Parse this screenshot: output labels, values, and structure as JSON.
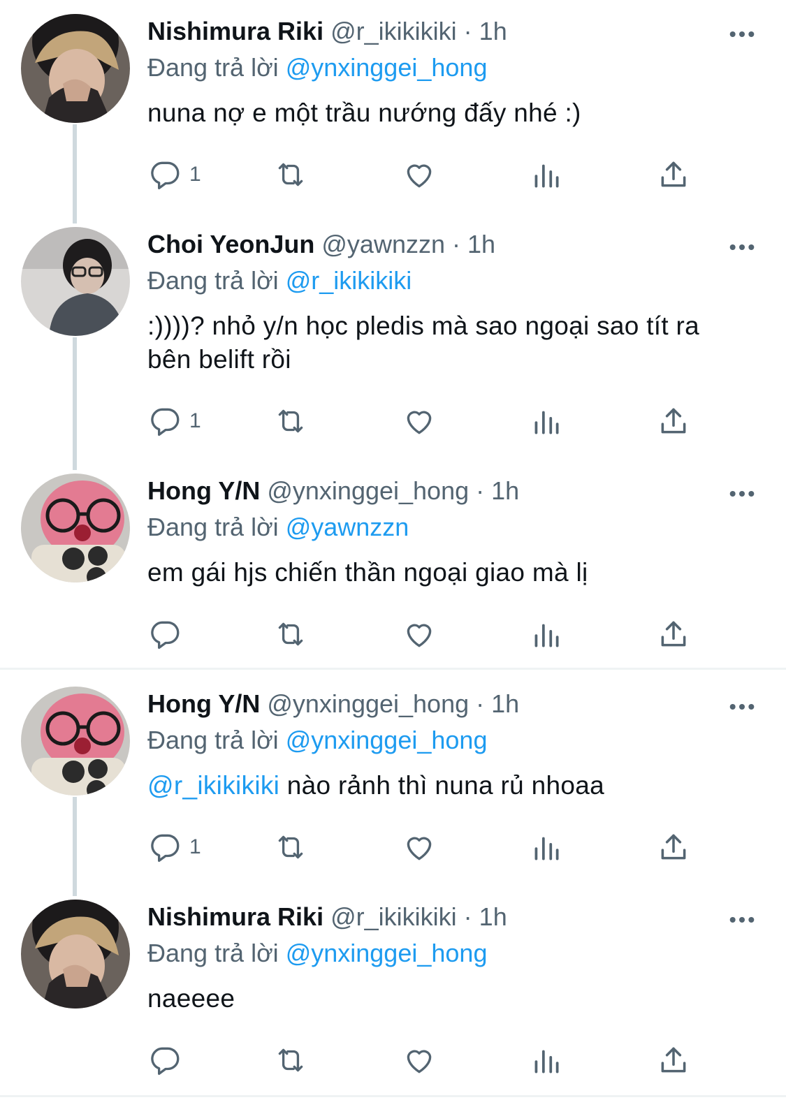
{
  "colors": {
    "link": "#1d9bf0",
    "secondary": "#536471",
    "text": "#0f1419",
    "thread_line": "#cfd9de"
  },
  "tweets": [
    {
      "name": "Nishimura Riki",
      "handle": "@r_ikikikiki",
      "dot": "·",
      "time": "1h",
      "reply_prefix": "Đang trả lời",
      "reply_to": "@ynxinggei_hong",
      "text": "nuna nợ e một trầu nướng đấy nhé :)",
      "reply_count": "1",
      "avatar_icon": "avatar-riki"
    },
    {
      "name": "Choi YeonJun",
      "handle": "@yawnzzn",
      "dot": "·",
      "time": "1h",
      "reply_prefix": "Đang trả lời",
      "reply_to": "@r_ikikikiki",
      "text": ":))))? nhỏ y/n học pledis mà sao ngoại sao tít ra bên belift rồi",
      "reply_count": "1",
      "avatar_icon": "avatar-yeonjun"
    },
    {
      "name": "Hong Y/N",
      "handle": "@ynxinggei_hong",
      "dot": "·",
      "time": "1h",
      "reply_prefix": "Đang trả lời",
      "reply_to": "@yawnzzn",
      "text": "em gái hjs chiến thần ngoại giao mà lị",
      "reply_count": "",
      "avatar_icon": "avatar-hong"
    },
    {
      "name": "Hong Y/N",
      "handle": "@ynxinggei_hong",
      "dot": "·",
      "time": "1h",
      "reply_prefix": "Đang trả lời",
      "reply_to": "@ynxinggei_hong",
      "text_mention": "@r_ikikikiki",
      "text": " nào rảnh thì nuna rủ nhoaa",
      "reply_count": "1",
      "avatar_icon": "avatar-hong"
    },
    {
      "name": "Nishimura Riki",
      "handle": "@r_ikikikiki",
      "dot": "·",
      "time": "1h",
      "reply_prefix": "Đang trả lời",
      "reply_to": "@ynxinggei_hong",
      "text": "naeeee",
      "reply_count": "",
      "avatar_icon": "avatar-riki"
    }
  ],
  "action_icons": [
    "reply-icon",
    "retweet-icon",
    "like-icon",
    "views-icon",
    "share-icon"
  ]
}
